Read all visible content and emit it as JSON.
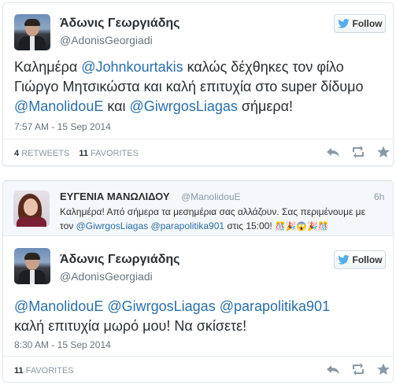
{
  "colors": {
    "mention": "#2c6ea3",
    "follow_bird": "#55acee",
    "muted": "#66757f"
  },
  "tweet1": {
    "author_name": "Άδωνις Γεωργιάδης",
    "author_handle": "@AdonisGeorgiadi",
    "follow_label": "Follow",
    "text_parts": [
      {
        "t": "Καλημέρα ",
        "mention": false
      },
      {
        "t": "@Johnkourtakis",
        "mention": true
      },
      {
        "t": " καλώς δέχθηκες τον φίλο Γιώργο Μητσικώστα και καλή επιτυχία στο super δίδυμο ",
        "mention": false
      },
      {
        "t": "@ManolidouE",
        "mention": true
      },
      {
        "t": " και ",
        "mention": false
      },
      {
        "t": "@GiwrgosLiagas",
        "mention": true
      },
      {
        "t": " σήμερα!",
        "mention": false
      }
    ],
    "timestamp": "7:57 AM - 15 Sep 2014",
    "retweets_count": "4",
    "retweets_label": "RETWEETS",
    "favorites_count": "11",
    "favorites_label": "FAVORITES",
    "actions": [
      "reply-icon",
      "retweet-icon",
      "favorite-icon"
    ]
  },
  "reply_context": {
    "author_name": "ΕΥΓΕΝΙΑ ΜΑΝΩΛΙΔΟΥ",
    "author_handle": "@ManolidouE",
    "time": "6h",
    "line1": "Καλημέρα! Από σήμερα τα μεσημέρια σας αλλάζουν. Σας περιμένουμε με",
    "line2_prefix": "τον ",
    "line2_mention1": "@GiwrgosLiagas",
    "line2_mention2": "@parapolitika901",
    "line2_suffix": " στις 15:00! ",
    "emoji": "🎊🎉😱🎉🎊"
  },
  "tweet2": {
    "author_name": "Άδωνις Γεωργιάδης",
    "author_handle": "@AdonisGeorgiadi",
    "follow_label": "Follow",
    "text_parts": [
      {
        "t": "@ManolidouE",
        "mention": true
      },
      {
        "t": " ",
        "mention": false
      },
      {
        "t": "@GiwrgosLiagas",
        "mention": true
      },
      {
        "t": " ",
        "mention": false
      },
      {
        "t": "@parapolitika901",
        "mention": true
      },
      {
        "t": " καλή επιτυχία μωρό μου! Να σκίσετε!",
        "mention": false
      }
    ],
    "timestamp": "8:30 AM - 15 Sep 2014",
    "favorites_count": "11",
    "favorites_label": "FAVORITES",
    "actions": [
      "reply-icon",
      "retweet-icon",
      "favorite-icon"
    ]
  }
}
